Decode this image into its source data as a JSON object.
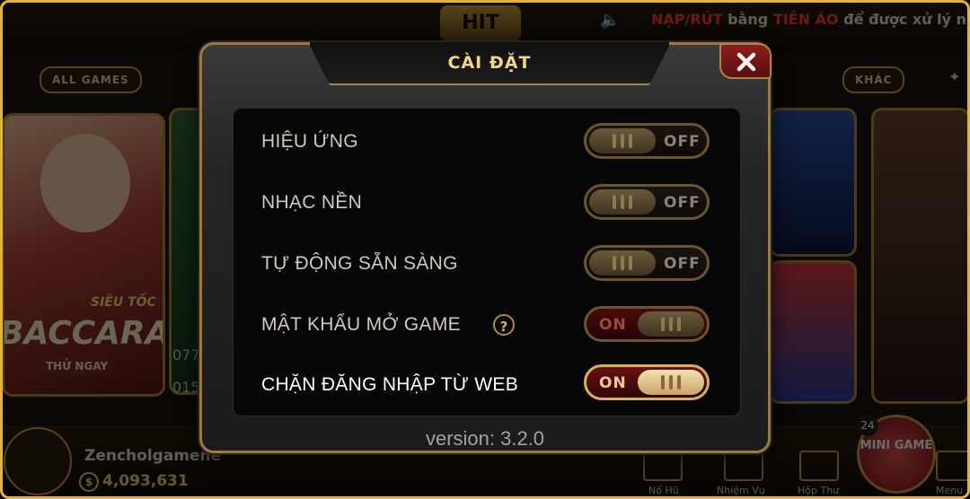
{
  "background": {
    "marquee_prefix": "NẠP/RÚT",
    "marquee_mid": " bằng ",
    "marquee_highlight": "TIỀN ẢO",
    "marquee_suffix": " để được xử lý nhanh",
    "all_games_label": "ALL GAMES",
    "other_label": "KHÁC",
    "baccarat_tag": "SIÊU TỐC",
    "baccarat_title": "BACCARAT",
    "play_now": "THỬ NGAY",
    "side_numbers": [
      "077",
      "015"
    ],
    "username": "Zencholgamene",
    "balance": "4,093,631",
    "mini_game_label": "MINI GAME",
    "mini_game_badge": "24",
    "nav_items": [
      "Nổ Hũ",
      "Nhiệm Vụ",
      "Hộp Thư",
      "Menu"
    ]
  },
  "settings": {
    "title": "CÀI ĐẶT",
    "rows": [
      {
        "label": "HIỆU ỨNG",
        "state": "OFF"
      },
      {
        "label": "NHẠC NỀN",
        "state": "OFF"
      },
      {
        "label": "TỰ ĐỘNG SẴN SÀNG",
        "state": "OFF"
      },
      {
        "label": "MẬT KHẨU MỞ GAME",
        "state": "ON",
        "help": "?"
      },
      {
        "label": "CHẶN ĐĂNG NHẬP TỪ WEB",
        "state": "ON"
      }
    ],
    "version": "version: 3.2.0"
  },
  "colors": {
    "accent_gold": "#e2b53a",
    "toggle_on": "#6a1010",
    "close_red": "#8f1d1d"
  }
}
